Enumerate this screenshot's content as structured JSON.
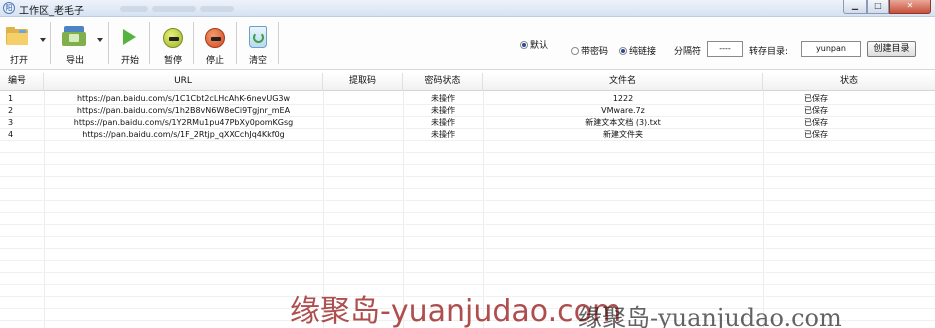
{
  "window": {
    "title": "工作区_老毛子",
    "app_icon_glyph": "阳",
    "controls": {
      "minimize": "▁",
      "maximize": "□",
      "close": "✕"
    }
  },
  "toolbar": {
    "open": "打开",
    "export": "导出",
    "start": "开始",
    "pause": "暂停",
    "stop": "停止",
    "clear": "清空"
  },
  "options": {
    "default_label": "默认",
    "with_password_label": "带密码",
    "pure_link_label": "纯链接",
    "default_selected": true,
    "with_password_selected": false,
    "pure_link_selected": true,
    "separator_label": "分隔符",
    "separator_value": "----",
    "save_dir_label": "转存目录:",
    "save_dir_value": "yunpan",
    "create_dir_button": "创建目录"
  },
  "table": {
    "columns": [
      "编号",
      "URL",
      "提取码",
      "密码状态",
      "文件名",
      "状态"
    ],
    "rows": [
      {
        "id": "1",
        "url": "https://pan.baidu.com/s/1C1Cbt2cLHcAhK-6nevUG3w",
        "code": "",
        "pwd_status": "未操作",
        "filename": "1222",
        "status": "已保存"
      },
      {
        "id": "2",
        "url": "https://pan.baidu.com/s/1h2B8vN6W8eCi9Tgjnr_mEA",
        "code": "",
        "pwd_status": "未操作",
        "filename": "VMware.7z",
        "status": "已保存"
      },
      {
        "id": "3",
        "url": "https://pan.baidu.com/s/1Y2RMu1pu47PbXy0pomKGsg",
        "code": "",
        "pwd_status": "未操作",
        "filename": "新建文本文档 (3).txt",
        "status": "已保存"
      },
      {
        "id": "4",
        "url": "https://pan.baidu.com/s/1F_2Rtjp_qXXCchJq4Kkf0g",
        "code": "",
        "pwd_status": "未操作",
        "filename": "新建文件夹",
        "status": "已保存"
      }
    ]
  },
  "watermark": {
    "text1": "缘聚岛-yuanjudao.com",
    "text2": "缘聚岛-yuanjudao.com"
  },
  "colors": {
    "play": "#55b43f",
    "pause": "#9db52a",
    "stop": "#d24a20",
    "watermark": "#a03030"
  }
}
